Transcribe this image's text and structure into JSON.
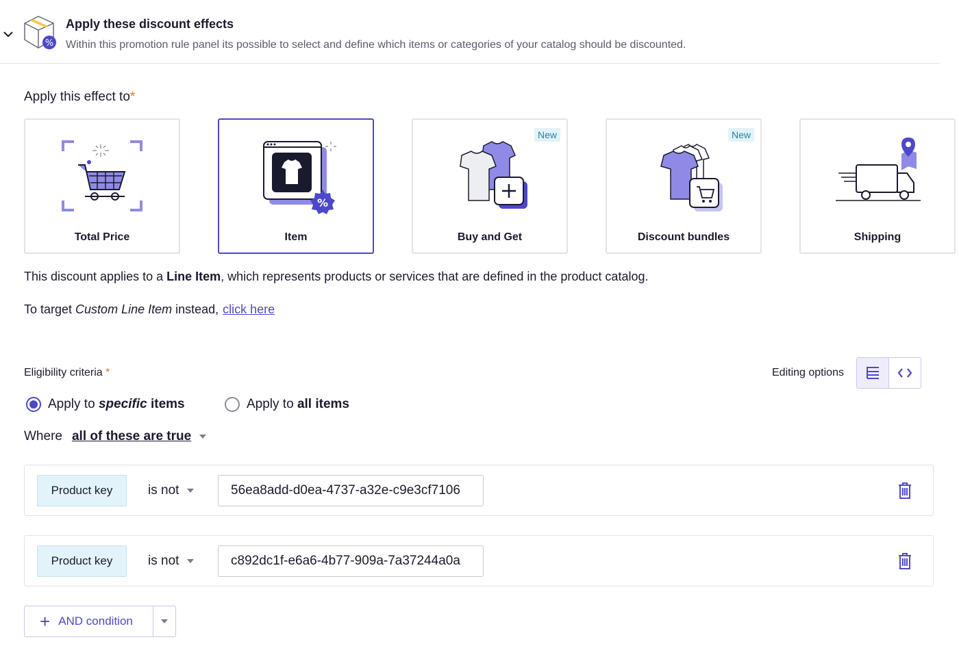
{
  "header": {
    "title": "Apply these discount effects",
    "description": "Within this promotion rule panel its possible to select and define which items or categories of your catalog should be discounted."
  },
  "effect": {
    "label": "Apply this effect to",
    "required_mark": "*",
    "cards": [
      {
        "label": "Total Price",
        "icon": "cart-icon",
        "selected": false,
        "badge": ""
      },
      {
        "label": "Item",
        "icon": "tshirt-icon",
        "selected": true,
        "badge": ""
      },
      {
        "label": "Buy and Get",
        "icon": "shirts-plus-icon",
        "selected": false,
        "badge": "New"
      },
      {
        "label": "Discount bundles",
        "icon": "bundle-icon",
        "selected": false,
        "badge": "New"
      },
      {
        "label": "Shipping",
        "icon": "truck-icon",
        "selected": false,
        "badge": ""
      }
    ]
  },
  "info": {
    "line1_pre": "This discount applies to a ",
    "line1_bold": "Line Item",
    "line1_post": ", which represents products or services that are defined in the product catalog.",
    "target_pre": "To target ",
    "target_italic": "Custom Line Item",
    "target_post": " instead,",
    "target_link": "click here"
  },
  "eligibility": {
    "label": "Eligibility criteria",
    "required_mark": "*",
    "editing_label": "Editing options",
    "radio_specific_pre": "Apply to ",
    "radio_specific_italic": "specific",
    "radio_specific_post": " items",
    "radio_all_pre": "Apply to ",
    "radio_all_bold": "all items",
    "selected_radio": "specific",
    "where_label": "Where",
    "where_pre": "all",
    "where_value": " of these are true"
  },
  "conditions": [
    {
      "field": "Product key",
      "operator": "is not",
      "value": "56ea8add-d0ea-4737-a32e-c9e3cf7106"
    },
    {
      "field": "Product key",
      "operator": "is not",
      "value": "c892dc1f-e6a6-4b77-909a-7a37244a0a"
    }
  ],
  "and_button": {
    "label": "AND condition"
  },
  "colors": {
    "accent": "#4d48c8",
    "required": "#e8702a",
    "badge_bg": "#e1f3f8",
    "key_bg": "#e2f3fa"
  }
}
